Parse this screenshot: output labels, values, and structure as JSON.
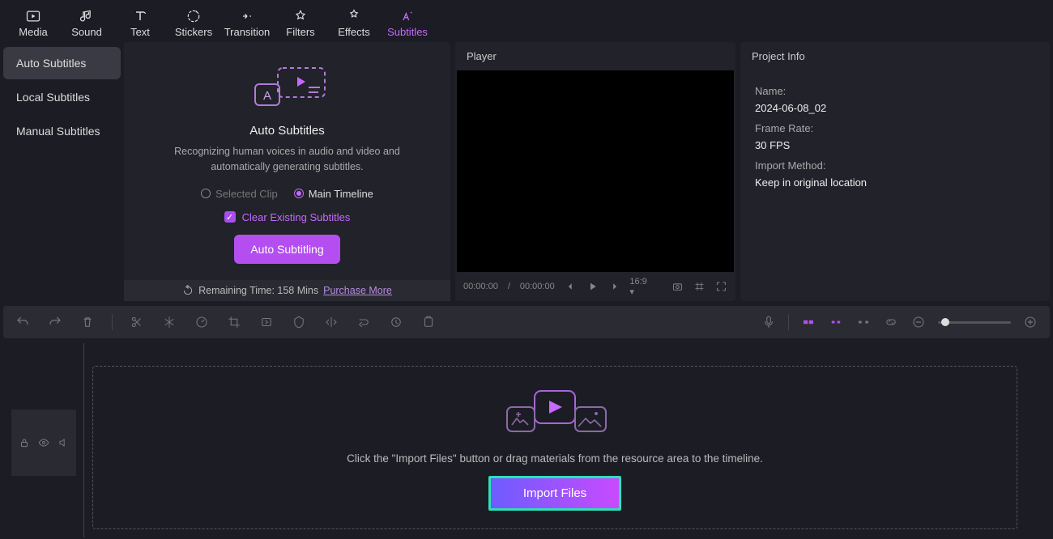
{
  "toolbar": {
    "items": [
      {
        "label": "Media",
        "icon": "media"
      },
      {
        "label": "Sound",
        "icon": "sound"
      },
      {
        "label": "Text",
        "icon": "text"
      },
      {
        "label": "Stickers",
        "icon": "stickers"
      },
      {
        "label": "Transition",
        "icon": "transition"
      },
      {
        "label": "Filters",
        "icon": "filters"
      },
      {
        "label": "Effects",
        "icon": "effects"
      },
      {
        "label": "Subtitles",
        "icon": "subtitles",
        "active": true
      }
    ]
  },
  "sub_tabs": [
    {
      "label": "Auto Subtitles",
      "active": true
    },
    {
      "label": "Local Subtitles"
    },
    {
      "label": "Manual Subtitles"
    }
  ],
  "auto_sub": {
    "title": "Auto Subtitles",
    "desc": "Recognizing human voices in audio and video and automatically generating subtitles.",
    "radio_selected": "Selected Clip",
    "radio_main": "Main Timeline",
    "radio_checked": "main",
    "clear_label": "Clear Existing Subtitles",
    "clear_checked": true,
    "button_label": "Auto Subtitling",
    "remain_prefix": "Remaining Time: 158 Mins ",
    "remain_link": "Purchase More"
  },
  "player": {
    "header": "Player",
    "time_current": "00:00:00",
    "time_total": "00:00:00",
    "aspect": "16:9"
  },
  "project": {
    "header": "Project Info",
    "name_label": "Name:",
    "name_value": "2024-06-08_02",
    "fps_label": "Frame Rate:",
    "fps_value": "30 FPS",
    "import_label": "Import Method:",
    "import_value": "Keep in original location"
  },
  "timeline": {
    "drop_desc": "Click the \"Import Files\" button or drag materials from the resource area to the timeline.",
    "import_label": "Import Files"
  }
}
